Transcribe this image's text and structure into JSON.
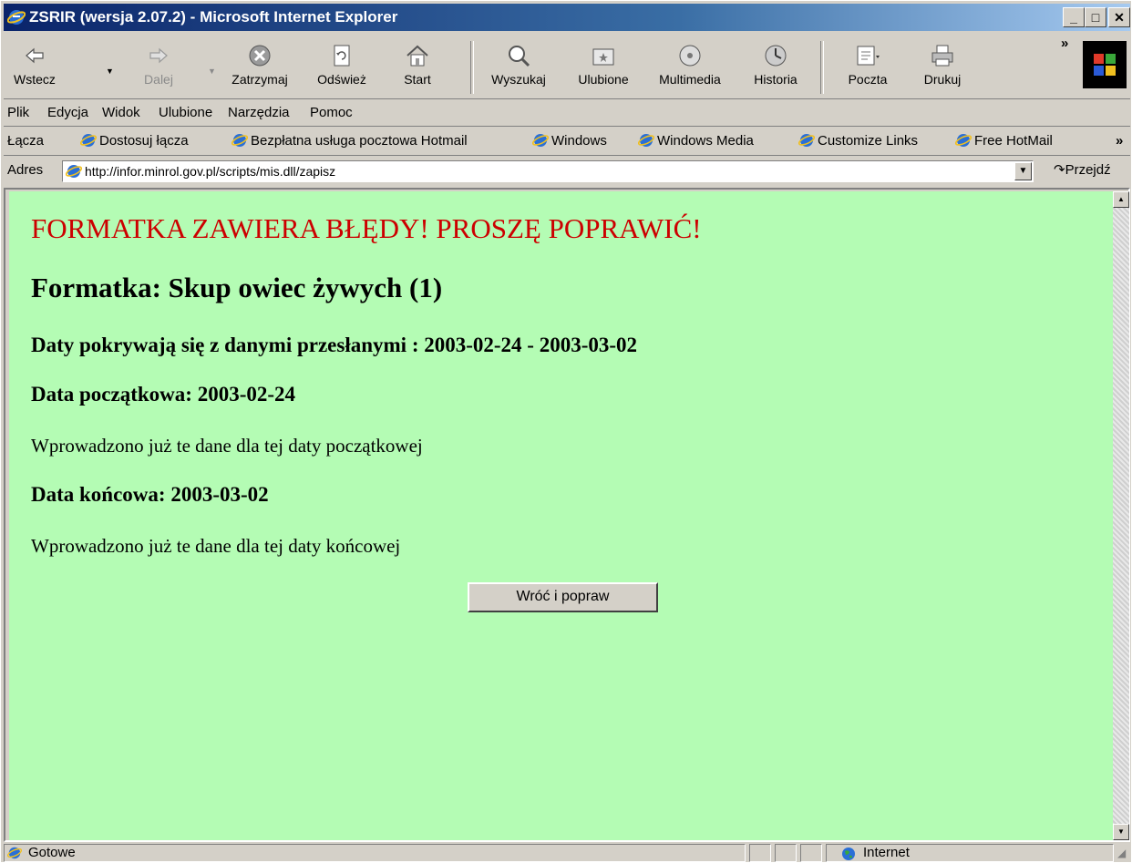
{
  "window": {
    "title": "ZSRIR (wersja 2.07.2) - Microsoft Internet Explorer"
  },
  "toolbar": {
    "buttons": [
      {
        "label": "Wstecz",
        "icon": "back-arrow-icon",
        "enabled": true
      },
      {
        "label": "Dalej",
        "icon": "forward-arrow-icon",
        "enabled": false
      },
      {
        "label": "Zatrzymaj",
        "icon": "stop-icon",
        "enabled": true
      },
      {
        "label": "Odśwież",
        "icon": "refresh-icon",
        "enabled": true
      },
      {
        "label": "Start",
        "icon": "home-icon",
        "enabled": true
      },
      {
        "label": "Wyszukaj",
        "icon": "search-icon",
        "enabled": true
      },
      {
        "label": "Ulubione",
        "icon": "favorites-icon",
        "enabled": true
      },
      {
        "label": "Multimedia",
        "icon": "multimedia-icon",
        "enabled": true
      },
      {
        "label": "Historia",
        "icon": "history-icon",
        "enabled": true
      },
      {
        "label": "Poczta",
        "icon": "mail-icon",
        "enabled": true
      },
      {
        "label": "Drukuj",
        "icon": "print-icon",
        "enabled": true
      }
    ],
    "overflow": "»"
  },
  "menu": {
    "items": [
      "Plik",
      "Edycja",
      "Widok",
      "Ulubione",
      "Narzędzia",
      "Pomoc"
    ]
  },
  "links": {
    "label": "Łącza",
    "items": [
      "Dostosuj łącza",
      "Bezpłatna usługa pocztowa Hotmail",
      "Windows",
      "Windows Media",
      "Customize Links",
      "Free HotMail"
    ],
    "overflow": "»"
  },
  "address": {
    "label": "Adres",
    "url": "http://infor.minrol.gov.pl/scripts/mis.dll/zapisz",
    "go_label": "Przejdź"
  },
  "page": {
    "error_heading": "FORMATKA ZAWIERA BŁĘDY! PROSZĘ POPRAWIĆ!",
    "form_heading": "Formatka: Skup owiec żywych (1)",
    "overlap_heading": "Daty pokrywają się z danymi przesłanymi : 2003-02-24 - 2003-03-02",
    "start_date_heading": "Data początkowa: 2003-02-24",
    "start_date_message": "Wprowadzono już te dane dla tej daty początkowej",
    "end_date_heading": "Data końcowa: 2003-03-02",
    "end_date_message": "Wprowadzono już te dane dla tej daty końcowej",
    "back_button": "Wróć i popraw",
    "background_color": "#b4fcb4",
    "error_color": "#cc0000"
  },
  "status": {
    "text": "Gotowe",
    "zone": "Internet"
  },
  "colors": {
    "titlebar_start": "#0a246a",
    "titlebar_end": "#a6caf0",
    "chrome": "#d4d0c8"
  }
}
